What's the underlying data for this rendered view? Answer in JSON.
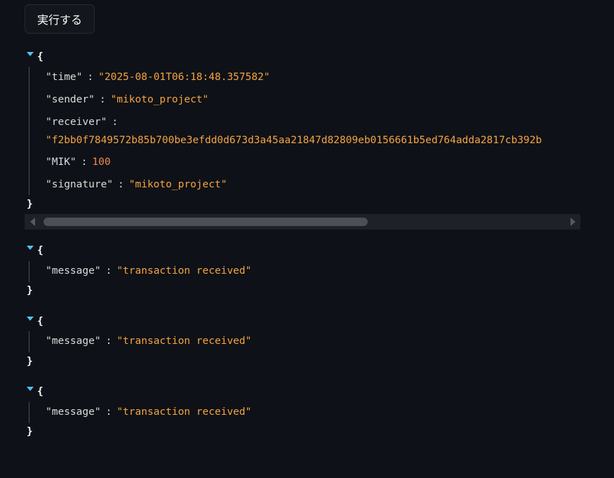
{
  "run_button": {
    "label": "実行する"
  },
  "blocks": [
    {
      "fields": [
        {
          "key": "\"time\"",
          "value": "\"2025-08-01T06:18:48.357582\""
        },
        {
          "key": "\"sender\"",
          "value": "\"mikoto_project\""
        },
        {
          "key": "\"receiver\"",
          "value": "\"f2bb0f7849572b85b700be3efdd0d673d3a45aa21847d82809eb0156661b5ed764adda2817cb392b"
        },
        {
          "key": "\"MIK\"",
          "value": "100"
        },
        {
          "key": "\"signature\"",
          "value": "\"mikoto_project\""
        }
      ]
    },
    {
      "fields": [
        {
          "key": "\"message\"",
          "value": "\"transaction received\""
        }
      ]
    },
    {
      "fields": [
        {
          "key": "\"message\"",
          "value": "\"transaction received\""
        }
      ]
    },
    {
      "fields": [
        {
          "key": "\"message\"",
          "value": "\"transaction received\""
        }
      ]
    }
  ],
  "punctuation": {
    "open": "{",
    "close": "}",
    "colon": ":"
  },
  "icons": {
    "toggle": "caret-down-icon",
    "scroll_left": "scroll-left-arrow-icon",
    "scroll_right": "scroll-right-arrow-icon"
  },
  "colors": {
    "background": "#0e1117",
    "string": "#f5a442",
    "number": "#f08a4b",
    "toggle": "#4fc3f7"
  }
}
